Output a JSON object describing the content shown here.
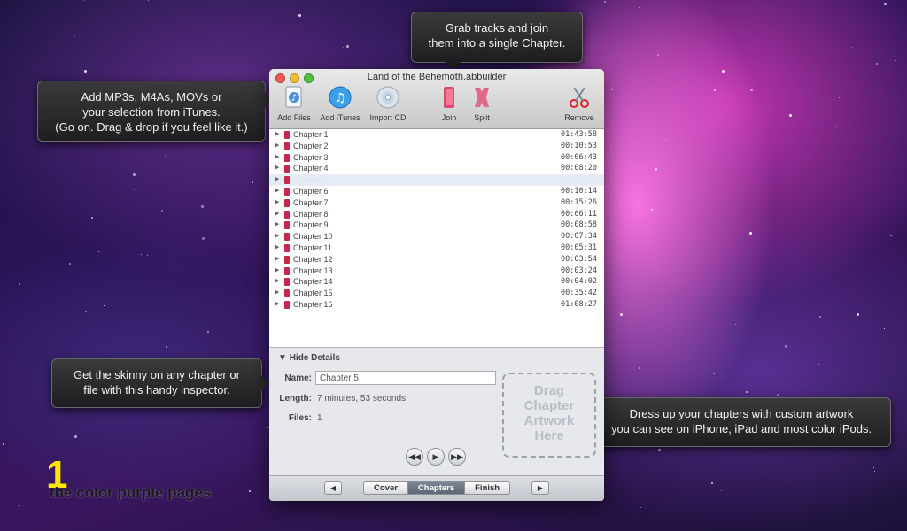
{
  "callouts": {
    "top": [
      "Grab tracks and join",
      "them into a single Chapter."
    ],
    "left_top": [
      "Add MP3s, M4As, MOVs or",
      "your selection from iTunes.",
      "(Go on. Drag & drop if you feel like it.)"
    ],
    "left_bottom": [
      "Get the skinny on any chapter or",
      "file with this handy inspector."
    ],
    "right_bottom": [
      "Dress up your chapters with custom artwork",
      "you can see on iPhone, iPad and most color iPods."
    ]
  },
  "window": {
    "title": "Land of the Behemoth.abbuilder",
    "toolbar": {
      "add_files": "Add Files",
      "add_itunes": "Add iTunes",
      "import_cd": "Import CD",
      "join": "Join",
      "split": "Split",
      "remove": "Remove"
    },
    "chapters": [
      {
        "name": "Chapter 1",
        "time": "01:43:58"
      },
      {
        "name": "Chapter 2",
        "time": "00:10:53"
      },
      {
        "name": "Chapter 3",
        "time": "00:06:43"
      },
      {
        "name": "Chapter 4",
        "time": "00:08:20"
      },
      {
        "name": "Chapter 5",
        "time": "00:07:53"
      },
      {
        "name": "Chapter 6",
        "time": "00:10:14"
      },
      {
        "name": "Chapter 7",
        "time": "00:15:26"
      },
      {
        "name": "Chapter 8",
        "time": "00:06:11"
      },
      {
        "name": "Chapter 9",
        "time": "00:08:58"
      },
      {
        "name": "Chapter 10",
        "time": "00:07:34"
      },
      {
        "name": "Chapter 11",
        "time": "00:05:31"
      },
      {
        "name": "Chapter 12",
        "time": "00:03:54"
      },
      {
        "name": "Chapter 13",
        "time": "00:03:24"
      },
      {
        "name": "Chapter 14",
        "time": "00:04:02"
      },
      {
        "name": "Chapter 15",
        "time": "00:35:42"
      },
      {
        "name": "Chapter 16",
        "time": "01:08:27"
      }
    ],
    "details": {
      "toggle": "Hide Details",
      "name_label": "Name:",
      "name_value": "Chapter 5",
      "length_label": "Length:",
      "length_value": "7 minutes, 53 seconds",
      "files_label": "Files:",
      "files_value": "1",
      "artwork_lines": [
        "Drag",
        "Chapter",
        "Artwork",
        "Here"
      ]
    },
    "bottom": {
      "prev": "◀",
      "next": "▶",
      "tabs": [
        "Cover",
        "Chapters",
        "Finish"
      ],
      "active_tab": "Chapters"
    }
  },
  "overlay": {
    "number": "1",
    "caption": "the color purple pages"
  }
}
